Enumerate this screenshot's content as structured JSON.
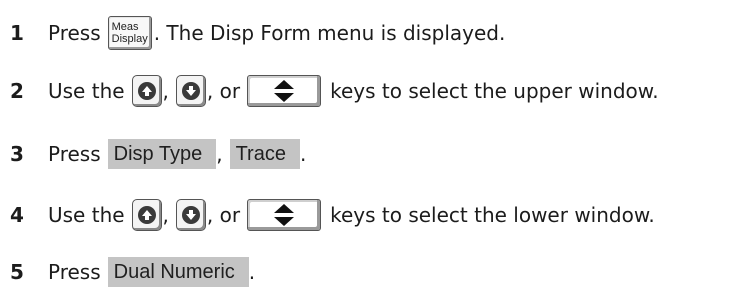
{
  "steps": [
    {
      "number": "1",
      "t1": "Press",
      "key_line1": "Meas",
      "key_line2": "Display",
      "t2": ". The Disp Form menu is displayed."
    },
    {
      "number": "2",
      "t1": "Use the",
      "sep1": ",",
      "sep2": ", or",
      "t2": "keys to select the upper window.",
      "icons": [
        "up-arrow-key-icon",
        "down-arrow-key-icon",
        "up-down-rotary-key-icon"
      ]
    },
    {
      "number": "3",
      "t1": "Press",
      "softkey1": "Disp Type",
      "sep": ",",
      "softkey2": "Trace",
      "end": "."
    },
    {
      "number": "4",
      "t1": "Use the",
      "sep1": ",",
      "sep2": ", or",
      "t2": "keys to select the lower window.",
      "icons": [
        "up-arrow-key-icon",
        "down-arrow-key-icon",
        "up-down-rotary-key-icon"
      ]
    },
    {
      "number": "5",
      "t1": "Press",
      "softkey1": "Dual Numeric",
      "end": "."
    }
  ]
}
